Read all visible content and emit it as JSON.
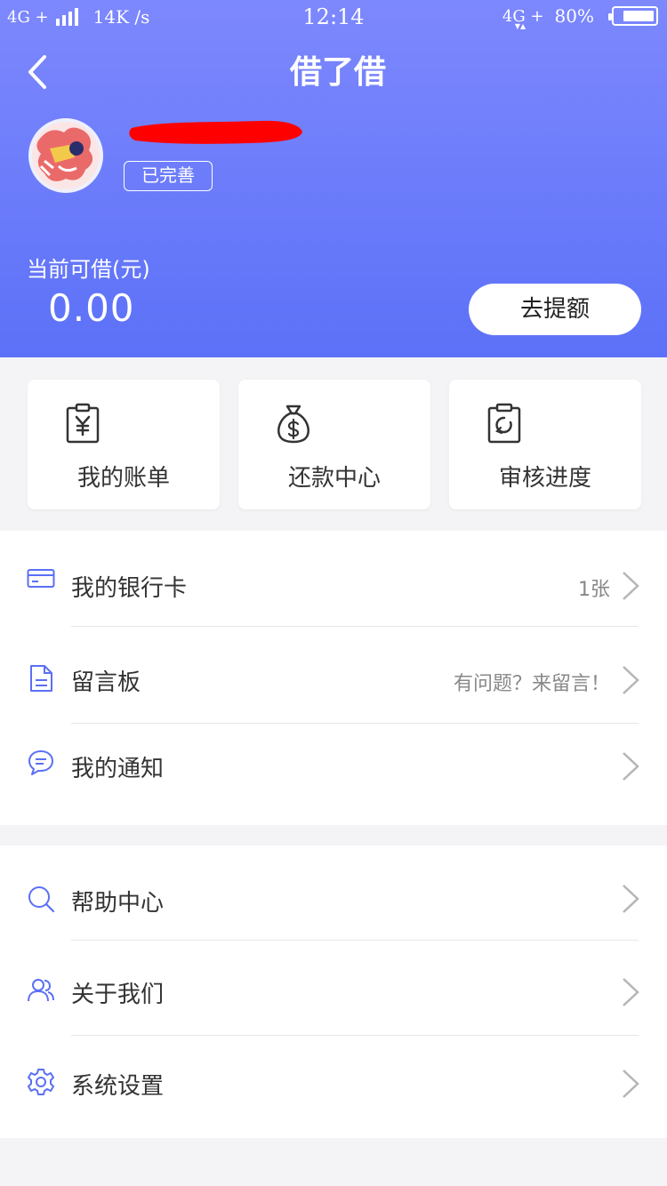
{
  "status_bar": {
    "network_left": "4G +",
    "speed": "14K /s",
    "time": "12:14",
    "network_right": "4G +",
    "battery_percent_text": "80%",
    "battery_level": 0.8
  },
  "nav": {
    "title": "借了借"
  },
  "profile": {
    "status_tag": "已完善"
  },
  "credit": {
    "label": "当前可借(元)",
    "amount": "0.00",
    "raise_button": "去提额"
  },
  "quick_actions": [
    {
      "label": "我的账单",
      "icon": "bill-yuan-icon"
    },
    {
      "label": "还款中心",
      "icon": "money-bag-icon"
    },
    {
      "label": "审核进度",
      "icon": "review-progress-icon"
    }
  ],
  "menu_section_1": [
    {
      "label": "我的银行卡",
      "value": "1张",
      "icon": "bank-card-icon"
    },
    {
      "label": "留言板",
      "value": "有问题？来留言！",
      "icon": "message-board-icon"
    },
    {
      "label": "我的通知",
      "value": "",
      "icon": "notification-chat-icon"
    }
  ],
  "menu_section_2": [
    {
      "label": "帮助中心",
      "value": "",
      "icon": "search-icon"
    },
    {
      "label": "关于我们",
      "value": "",
      "icon": "users-icon"
    },
    {
      "label": "系统设置",
      "value": "",
      "icon": "gear-icon"
    }
  ],
  "colors": {
    "header_top": "#7d88fd",
    "header_bottom": "#5c71f8",
    "icon_blue": "#5b6ff5",
    "redaction": "#ff0000"
  }
}
